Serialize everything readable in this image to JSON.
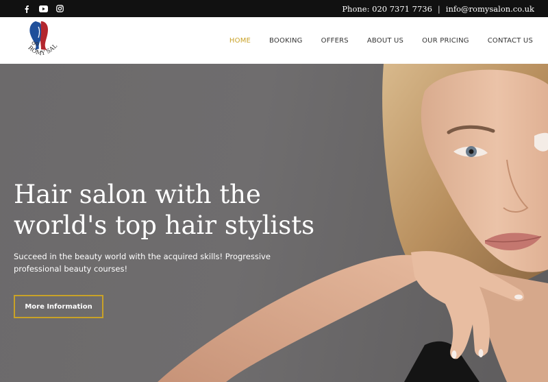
{
  "topbar": {
    "social": [
      {
        "icon": "facebook-icon",
        "glyph": "f"
      },
      {
        "icon": "youtube-icon",
        "glyph": "▶"
      },
      {
        "icon": "instagram-icon",
        "glyph": "◎"
      }
    ],
    "phone": "Phone: 020 7371 7736",
    "separator": "|",
    "email": "info@romysalon.co.uk"
  },
  "header": {
    "logo_text": "ROMY SALON",
    "nav": [
      {
        "label": "HOME",
        "active": true
      },
      {
        "label": "BOOKING"
      },
      {
        "label": "OFFERS"
      },
      {
        "label": "ABOUT US"
      },
      {
        "label": "OUR PRICING"
      },
      {
        "label": "CONTACT US"
      }
    ]
  },
  "hero": {
    "title_line1": "Hair salon with the",
    "title_line2": "world's top hair stylists",
    "subtitle": "Succeed in the beauty world with the acquired skills! Progressive professional beauty courses!",
    "button_label": "More Information"
  },
  "colors": {
    "accent": "#c9a227",
    "topbar_bg": "#111111",
    "hero_bg": "#6c6a6b"
  }
}
